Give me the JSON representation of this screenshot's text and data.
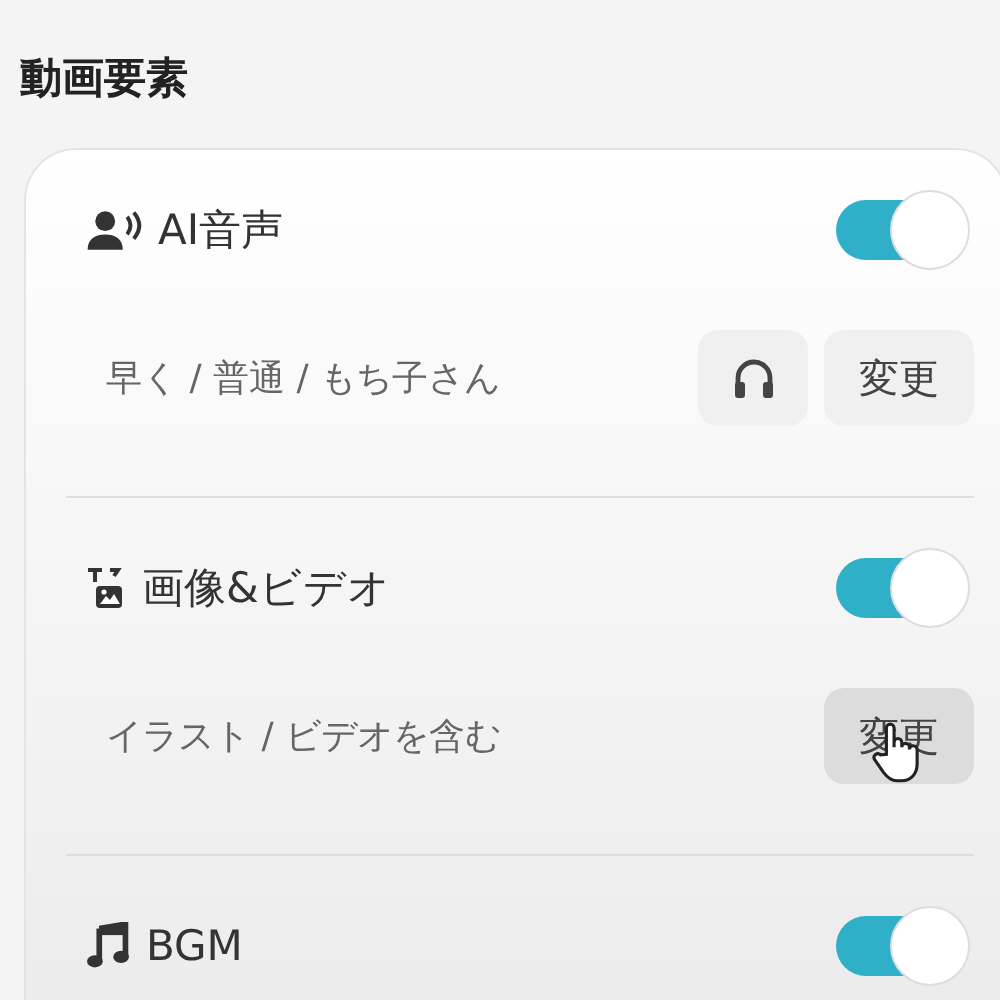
{
  "heading": "動画要素",
  "items": [
    {
      "kind": "voice",
      "title": "AI音声",
      "on": true,
      "detail": "早く / 普通 / もち子さん",
      "actions": [
        {
          "kind": "listen",
          "hovered": false
        },
        {
          "kind": "change",
          "label": "変更",
          "hovered": false
        }
      ]
    },
    {
      "kind": "media",
      "title": "画像&ビデオ",
      "on": true,
      "detail": "イラスト / ビデオを含む",
      "actions": [
        {
          "kind": "change",
          "label": "変更",
          "hovered": true
        }
      ]
    },
    {
      "kind": "music",
      "title": "BGM",
      "on": true
    }
  ]
}
